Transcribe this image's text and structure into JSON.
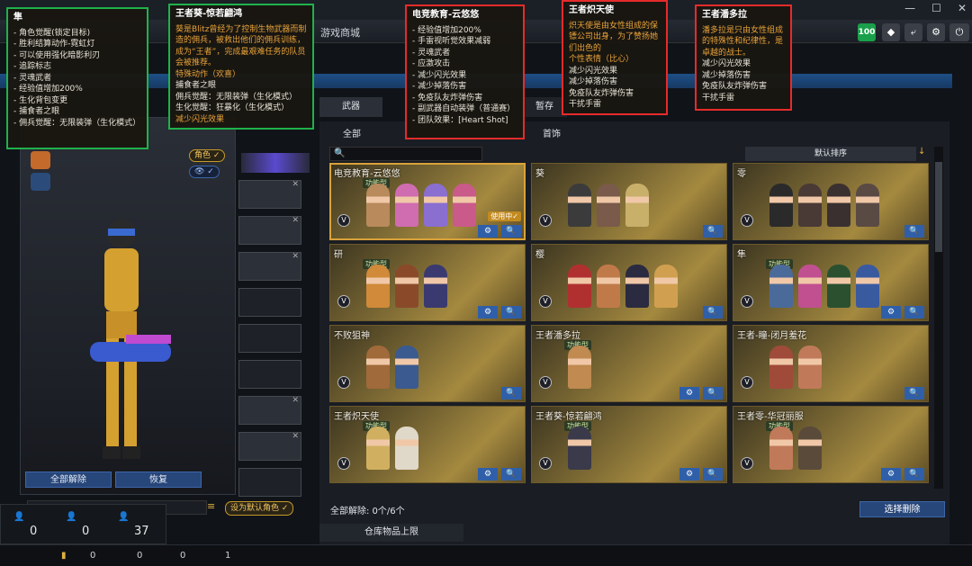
{
  "nav": {
    "shop": "游戏商城",
    "weapon_tab": "武器",
    "storage_tab": "暂存",
    "subtab_all": "全部",
    "subtab_jewelry": "首饰",
    "level": "100"
  },
  "left": {
    "role_pill": "角色 ✓",
    "btn_unequip_all": "全部解除",
    "btn_restore": "恢复",
    "btn_set_default": "设为默认角色 ✓",
    "counts": [
      "0",
      "0",
      "37"
    ]
  },
  "status": {
    "a": "0",
    "b": "0",
    "c": "0",
    "d": "1"
  },
  "right": {
    "sort_label": "默认排序",
    "unequip_all_label": "全部解除: 0个/6个",
    "select_delete": "选择删除",
    "warehouse": "仓库物品上限"
  },
  "cards": [
    {
      "title": "电竞教育-云悠悠",
      "badge": "功能型",
      "in_use": "使用中✓",
      "colors": [
        "#b88a5c",
        "#d06cb0",
        "#8a6ed0",
        "#c95a8a"
      ]
    },
    {
      "title": "葵",
      "badge": "",
      "in_use": "",
      "colors": [
        "#3b3b3b",
        "#7a5a4a",
        "#c9b06a"
      ]
    },
    {
      "title": "零",
      "badge": "",
      "in_use": "",
      "colors": [
        "#2a2a2a",
        "#4a3a35",
        "#3a3030",
        "#5a4a44"
      ]
    },
    {
      "title": "研",
      "badge": "功能型",
      "in_use": "",
      "colors": [
        "#d08a3a",
        "#8a4a2a",
        "#3a3a70"
      ]
    },
    {
      "title": "樱",
      "badge": "",
      "in_use": "",
      "colors": [
        "#b03030",
        "#c07a4a",
        "#2a2a40",
        "#d0a050"
      ]
    },
    {
      "title": "隼",
      "badge": "功能型",
      "in_use": "",
      "colors": [
        "#4a6a9a",
        "#c05090",
        "#2a5030",
        "#3a5aa0"
      ]
    },
    {
      "title": "不败狙神",
      "badge": "",
      "in_use": "",
      "colors": [
        "#a06a3a",
        "#3a5a90"
      ]
    },
    {
      "title": "王者潘多拉",
      "badge": "功能型",
      "in_use": "",
      "colors": [
        "#c08a50"
      ]
    },
    {
      "title": "王者-瞳-闭月羞花",
      "badge": "",
      "in_use": "",
      "colors": [
        "#a04a3a",
        "#c07a5a"
      ]
    },
    {
      "title": "王者炽天使",
      "badge": "功能型",
      "in_use": "",
      "colors": [
        "#d0b060",
        "#e0d8c8"
      ]
    },
    {
      "title": "王者葵-惊若翩鸿",
      "badge": "功能型",
      "in_use": "",
      "colors": [
        "#3a3a4a"
      ]
    },
    {
      "title": "王者零-华冠丽服",
      "badge": "功能型",
      "in_use": "",
      "colors": [
        "#c07a5a",
        "#5a4a3a"
      ]
    }
  ],
  "annotations": {
    "sun": {
      "title": "隼",
      "lines": [
        "- 角色觉醒(锁定目标)",
        "- 胜利结算动作-霓虹灯",
        "- 可以使用强化暗影利刃",
        "- 追踪标志",
        "- 灵魂武者",
        "- 经验值增加200%",
        "- 生化背包变更",
        "- 捕食者之眼",
        "- 佣兵觉醒：无限装弹（生化模式）"
      ]
    },
    "kui": {
      "title": "王者葵-惊若翩鸿",
      "desc": "葵是Blitz曾经为了控制生物武器而制造的佣兵，被救出他们的佣兵训练，成为“王者”，完成最艰难任务的队员会被推荐。",
      "orange_lines": [
        "特殊动作（欢喜）"
      ],
      "lines": [
        "捕食者之眼",
        "佣兵觉醒：无限装弹（生化模式）",
        "生化觉醒：狂暴化（生化模式）"
      ],
      "tail_orange": [
        "减少闪光效果"
      ]
    },
    "yunyouyou": {
      "title": "电竞教育-云悠悠",
      "lines": [
        "- 经验值增加200%",
        "- 手雷视听觉效果减弱",
        "- 灵魂武者",
        "- 应激攻击",
        "- 减少闪光效果",
        "- 减少掉落伤害",
        "- 免疫队友炸弹伤害",
        "- 副武器自动装弹（普通赛）",
        "- 团队效果：[Heart Shot]"
      ]
    },
    "chitianshi": {
      "title": "王者炽天使",
      "desc": "炽天使是由女性组成的保镖公司出身，为了赞扬她们出色的",
      "orange_lines": [
        "个性表情（比心）"
      ],
      "lines": [
        "减少闪光效果",
        "减少掉落伤害",
        "免疫队友炸弹伤害",
        "干扰手雷"
      ]
    },
    "panduola": {
      "title": "王者潘多拉",
      "desc": "潘多拉是只由女性组成的特殊性和纪律性，是卓越的战士。",
      "lines": [
        "减少闪光效果",
        "减少掉落伤害",
        "免疫队友炸弹伤害",
        "干扰手雷"
      ]
    }
  }
}
